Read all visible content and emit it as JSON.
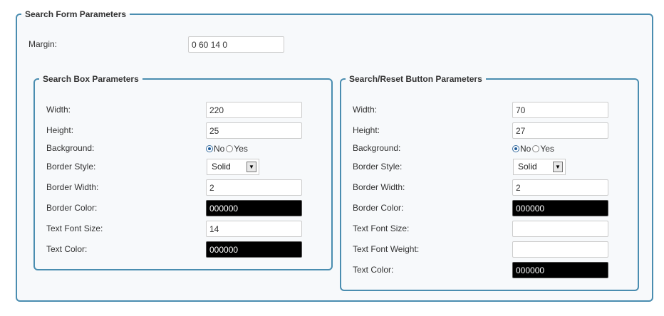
{
  "search_form": {
    "legend": "Search Form Parameters",
    "margin_label": "Margin:",
    "margin_value": "0 60 14 0"
  },
  "search_box": {
    "legend": "Search Box Parameters",
    "width_label": "Width:",
    "width_value": "220",
    "height_label": "Height:",
    "height_value": "25",
    "background_label": "Background:",
    "background_options": [
      "No",
      "Yes"
    ],
    "background_selected": "No",
    "border_style_label": "Border Style:",
    "border_style_value": "Solid",
    "border_width_label": "Border Width:",
    "border_width_value": "2",
    "border_color_label": "Border Color:",
    "border_color_value": "000000",
    "text_font_size_label": "Text Font Size:",
    "text_font_size_value": "14",
    "text_color_label": "Text Color:",
    "text_color_value": "000000"
  },
  "button": {
    "legend": "Search/Reset Button Parameters",
    "width_label": "Width:",
    "width_value": "70",
    "height_label": "Height:",
    "height_value": "27",
    "background_label": "Background:",
    "background_options": [
      "No",
      "Yes"
    ],
    "background_selected": "No",
    "border_style_label": "Border Style:",
    "border_style_value": "Solid",
    "border_width_label": "Border Width:",
    "border_width_value": "2",
    "border_color_label": "Border Color:",
    "border_color_value": "000000",
    "text_font_size_label": "Text Font Size:",
    "text_font_size_value": "",
    "text_font_weight_label": "Text Font Weight:",
    "text_font_weight_value": "",
    "text_color_label": "Text Color:",
    "text_color_value": "000000"
  },
  "colors": {
    "fieldset_border": "#4a8db0",
    "panel_background": "#f7f9fb",
    "color_swatch": "#000000"
  },
  "icons": {
    "select_arrow": "chevron-down-icon"
  }
}
